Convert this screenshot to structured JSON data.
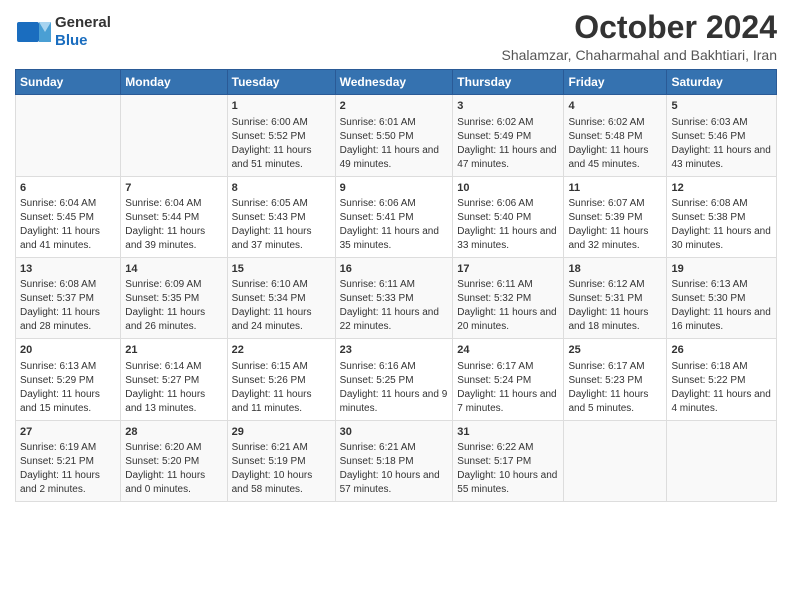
{
  "logo": {
    "general": "General",
    "blue": "Blue"
  },
  "title": "October 2024",
  "subtitle": "Shalamzar, Chaharmahal and Bakhtiari, Iran",
  "days": [
    "Sunday",
    "Monday",
    "Tuesday",
    "Wednesday",
    "Thursday",
    "Friday",
    "Saturday"
  ],
  "weeks": [
    [
      {
        "num": "",
        "sunrise": "",
        "sunset": "",
        "daylight": ""
      },
      {
        "num": "",
        "sunrise": "",
        "sunset": "",
        "daylight": ""
      },
      {
        "num": "1",
        "sunrise": "Sunrise: 6:00 AM",
        "sunset": "Sunset: 5:52 PM",
        "daylight": "Daylight: 11 hours and 51 minutes."
      },
      {
        "num": "2",
        "sunrise": "Sunrise: 6:01 AM",
        "sunset": "Sunset: 5:50 PM",
        "daylight": "Daylight: 11 hours and 49 minutes."
      },
      {
        "num": "3",
        "sunrise": "Sunrise: 6:02 AM",
        "sunset": "Sunset: 5:49 PM",
        "daylight": "Daylight: 11 hours and 47 minutes."
      },
      {
        "num": "4",
        "sunrise": "Sunrise: 6:02 AM",
        "sunset": "Sunset: 5:48 PM",
        "daylight": "Daylight: 11 hours and 45 minutes."
      },
      {
        "num": "5",
        "sunrise": "Sunrise: 6:03 AM",
        "sunset": "Sunset: 5:46 PM",
        "daylight": "Daylight: 11 hours and 43 minutes."
      }
    ],
    [
      {
        "num": "6",
        "sunrise": "Sunrise: 6:04 AM",
        "sunset": "Sunset: 5:45 PM",
        "daylight": "Daylight: 11 hours and 41 minutes."
      },
      {
        "num": "7",
        "sunrise": "Sunrise: 6:04 AM",
        "sunset": "Sunset: 5:44 PM",
        "daylight": "Daylight: 11 hours and 39 minutes."
      },
      {
        "num": "8",
        "sunrise": "Sunrise: 6:05 AM",
        "sunset": "Sunset: 5:43 PM",
        "daylight": "Daylight: 11 hours and 37 minutes."
      },
      {
        "num": "9",
        "sunrise": "Sunrise: 6:06 AM",
        "sunset": "Sunset: 5:41 PM",
        "daylight": "Daylight: 11 hours and 35 minutes."
      },
      {
        "num": "10",
        "sunrise": "Sunrise: 6:06 AM",
        "sunset": "Sunset: 5:40 PM",
        "daylight": "Daylight: 11 hours and 33 minutes."
      },
      {
        "num": "11",
        "sunrise": "Sunrise: 6:07 AM",
        "sunset": "Sunset: 5:39 PM",
        "daylight": "Daylight: 11 hours and 32 minutes."
      },
      {
        "num": "12",
        "sunrise": "Sunrise: 6:08 AM",
        "sunset": "Sunset: 5:38 PM",
        "daylight": "Daylight: 11 hours and 30 minutes."
      }
    ],
    [
      {
        "num": "13",
        "sunrise": "Sunrise: 6:08 AM",
        "sunset": "Sunset: 5:37 PM",
        "daylight": "Daylight: 11 hours and 28 minutes."
      },
      {
        "num": "14",
        "sunrise": "Sunrise: 6:09 AM",
        "sunset": "Sunset: 5:35 PM",
        "daylight": "Daylight: 11 hours and 26 minutes."
      },
      {
        "num": "15",
        "sunrise": "Sunrise: 6:10 AM",
        "sunset": "Sunset: 5:34 PM",
        "daylight": "Daylight: 11 hours and 24 minutes."
      },
      {
        "num": "16",
        "sunrise": "Sunrise: 6:11 AM",
        "sunset": "Sunset: 5:33 PM",
        "daylight": "Daylight: 11 hours and 22 minutes."
      },
      {
        "num": "17",
        "sunrise": "Sunrise: 6:11 AM",
        "sunset": "Sunset: 5:32 PM",
        "daylight": "Daylight: 11 hours and 20 minutes."
      },
      {
        "num": "18",
        "sunrise": "Sunrise: 6:12 AM",
        "sunset": "Sunset: 5:31 PM",
        "daylight": "Daylight: 11 hours and 18 minutes."
      },
      {
        "num": "19",
        "sunrise": "Sunrise: 6:13 AM",
        "sunset": "Sunset: 5:30 PM",
        "daylight": "Daylight: 11 hours and 16 minutes."
      }
    ],
    [
      {
        "num": "20",
        "sunrise": "Sunrise: 6:13 AM",
        "sunset": "Sunset: 5:29 PM",
        "daylight": "Daylight: 11 hours and 15 minutes."
      },
      {
        "num": "21",
        "sunrise": "Sunrise: 6:14 AM",
        "sunset": "Sunset: 5:27 PM",
        "daylight": "Daylight: 11 hours and 13 minutes."
      },
      {
        "num": "22",
        "sunrise": "Sunrise: 6:15 AM",
        "sunset": "Sunset: 5:26 PM",
        "daylight": "Daylight: 11 hours and 11 minutes."
      },
      {
        "num": "23",
        "sunrise": "Sunrise: 6:16 AM",
        "sunset": "Sunset: 5:25 PM",
        "daylight": "Daylight: 11 hours and 9 minutes."
      },
      {
        "num": "24",
        "sunrise": "Sunrise: 6:17 AM",
        "sunset": "Sunset: 5:24 PM",
        "daylight": "Daylight: 11 hours and 7 minutes."
      },
      {
        "num": "25",
        "sunrise": "Sunrise: 6:17 AM",
        "sunset": "Sunset: 5:23 PM",
        "daylight": "Daylight: 11 hours and 5 minutes."
      },
      {
        "num": "26",
        "sunrise": "Sunrise: 6:18 AM",
        "sunset": "Sunset: 5:22 PM",
        "daylight": "Daylight: 11 hours and 4 minutes."
      }
    ],
    [
      {
        "num": "27",
        "sunrise": "Sunrise: 6:19 AM",
        "sunset": "Sunset: 5:21 PM",
        "daylight": "Daylight: 11 hours and 2 minutes."
      },
      {
        "num": "28",
        "sunrise": "Sunrise: 6:20 AM",
        "sunset": "Sunset: 5:20 PM",
        "daylight": "Daylight: 11 hours and 0 minutes."
      },
      {
        "num": "29",
        "sunrise": "Sunrise: 6:21 AM",
        "sunset": "Sunset: 5:19 PM",
        "daylight": "Daylight: 10 hours and 58 minutes."
      },
      {
        "num": "30",
        "sunrise": "Sunrise: 6:21 AM",
        "sunset": "Sunset: 5:18 PM",
        "daylight": "Daylight: 10 hours and 57 minutes."
      },
      {
        "num": "31",
        "sunrise": "Sunrise: 6:22 AM",
        "sunset": "Sunset: 5:17 PM",
        "daylight": "Daylight: 10 hours and 55 minutes."
      },
      {
        "num": "",
        "sunrise": "",
        "sunset": "",
        "daylight": ""
      },
      {
        "num": "",
        "sunrise": "",
        "sunset": "",
        "daylight": ""
      }
    ]
  ]
}
